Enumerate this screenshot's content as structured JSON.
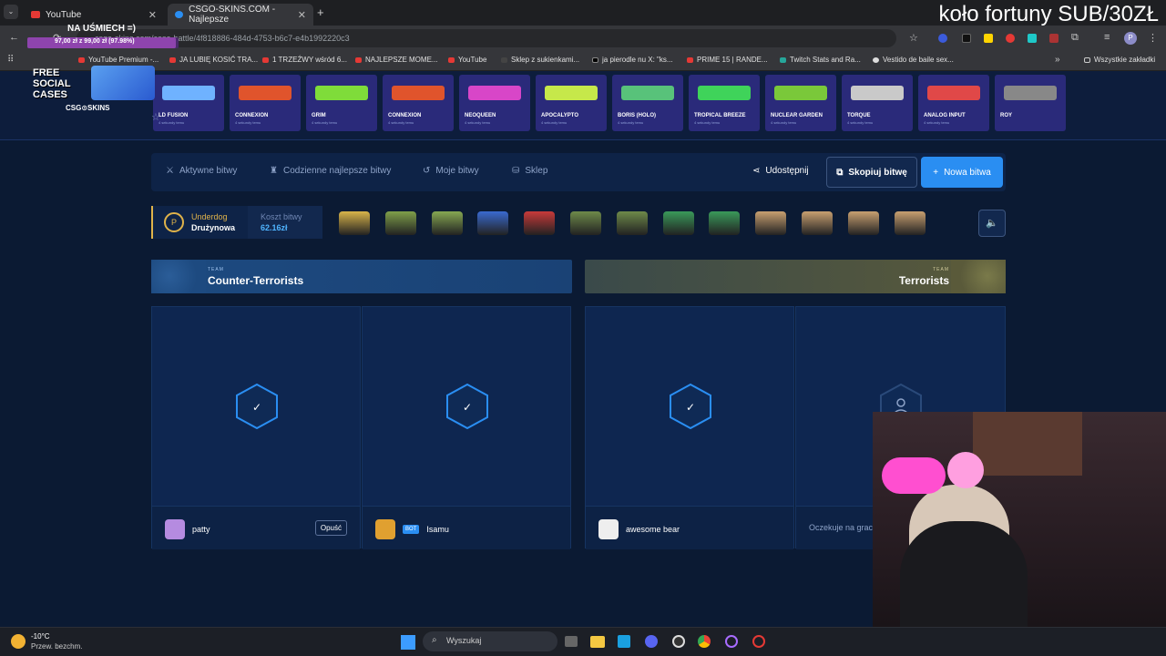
{
  "browser": {
    "tabs": [
      {
        "title": "YouTube",
        "active": false
      },
      {
        "title": "CSGO-SKINS.COM - Najlepsze",
        "active": true
      }
    ],
    "url": "csgo-skins.com/case-battle/4f818886-484d-4753-b6c7-e4b1992220c3",
    "bookmarks": [
      "YouTube Premium -...",
      "JA LUBIĘ KOSIĆ TRA...",
      "1 TRZEŹWY wśród 6...",
      "NAJLEPSZE MOME...",
      "YouTube",
      "Sklep z sukienkami...",
      "ja pierodle nu X: \"ks...",
      "PRIME 15 | RANDE...",
      "Twitch Stats and Ra...",
      "Vestido de baile sex..."
    ],
    "all_bookmarks": "Wszystkie zakładki"
  },
  "stream": {
    "title": "koło fortuny SUB/30ZŁ",
    "goal_title": "NA UŚMIECH =)",
    "goal_progress": "97,00 zł z 99,00 zł (97.98%)",
    "goal_fraction": 0.9798,
    "promo_text": "FREE SOCIAL CASES",
    "promo_brand": "CSG⊙SKINS"
  },
  "ticker": [
    {
      "name": "LD FUSION",
      "sub": "4 sekundy temu",
      "color": "#6fb2ff"
    },
    {
      "name": "CONNEXION",
      "sub": "4 sekundy temu",
      "color": "#e0542c"
    },
    {
      "name": "GRIM",
      "sub": "4 sekundy temu",
      "color": "#7fdc3a"
    },
    {
      "name": "CONNEXION",
      "sub": "4 sekundy temu",
      "color": "#e0542c"
    },
    {
      "name": "NEOQUEEN",
      "sub": "4 sekundy temu",
      "color": "#d846c8"
    },
    {
      "name": "APOCALYPTO",
      "sub": "4 sekundy temu",
      "color": "#c6e84a"
    },
    {
      "name": "BORIS (HOLO)",
      "sub": "4 sekundy temu",
      "color": "#58c27a"
    },
    {
      "name": "TROPICAL BREEZE",
      "sub": "4 sekundy temu",
      "color": "#3fd35a"
    },
    {
      "name": "NUCLEAR GARDEN",
      "sub": "4 sekundy temu",
      "color": "#7ac83a"
    },
    {
      "name": "TORQUE",
      "sub": "4 sekundy temu",
      "color": "#c9c9c9"
    },
    {
      "name": "ANALOG INPUT",
      "sub": "4 sekundy temu",
      "color": "#e04848"
    },
    {
      "name": "ROY",
      "sub": "",
      "color": "#888888"
    }
  ],
  "nav": {
    "active_battles": "Aktywne bitwy",
    "daily_best": "Codzienne najlepsze bitwy",
    "my_battles": "Moje bitwy",
    "shop": "Sklep",
    "share": "Udostępnij",
    "copy": "Skopiuj bitwę",
    "new": "Nowa bitwa"
  },
  "battle": {
    "mode": "Underdog",
    "type": "Drużynowa",
    "cost_label": "Koszt bitwy",
    "cost": "62.16zł",
    "cases": [
      "#d8b44a",
      "#7fa04a",
      "#86a852",
      "#3a6ad0",
      "#c83a3a",
      "#6e8a4a",
      "#6e8a4a",
      "#3a9a5a",
      "#3a9a5a",
      "#c8a070",
      "#c8a070",
      "#c8a070",
      "#c8a070"
    ]
  },
  "teams": [
    {
      "label": "TEAM",
      "name": "Counter-Terrorists"
    },
    {
      "label": "TEAM",
      "name": "Terrorists"
    }
  ],
  "slots": [
    {
      "player": "patty",
      "action": "Opuść",
      "bot": false
    },
    {
      "player": "Isamu",
      "bot": true,
      "bot_label": "BOT"
    },
    {
      "player": "awesome bear",
      "bot": false
    },
    {
      "player": "Oczekuje na grac",
      "waiting": true
    }
  ],
  "taskbar": {
    "temp": "-10°C",
    "weather": "Przew. bezchm.",
    "search": "Wyszukaj"
  }
}
